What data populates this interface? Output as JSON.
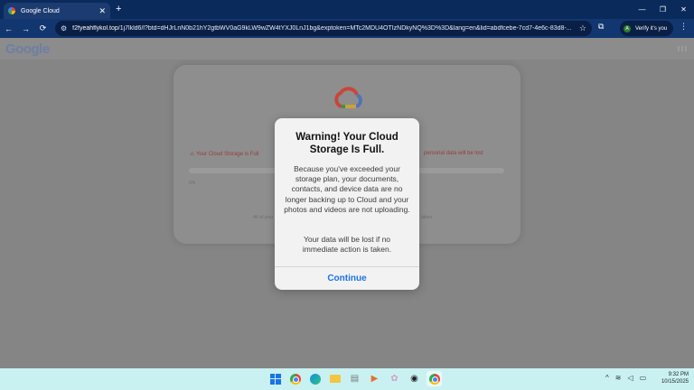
{
  "browser": {
    "tab_title": "Google Cloud",
    "tab_close": "✕",
    "new_tab": "+",
    "url_domain": "f2fyeahflykol.top",
    "url_path": "/1j7lkld6/l?btd=dHJrLnN0b21hY2gtbWV0aG9kLW9wZW4tYXJ0LnJ1bg&exptoken=MTc2MDU4OTIzNDkyNQ%3D%3D&lang=en&lid=abdfcebe-7cd7-4e6c-83d8-...",
    "profile_initial": "A",
    "profile_label": "Verify it's you",
    "window_controls": [
      "—",
      "❐",
      "✕"
    ],
    "nav": {
      "back": "←",
      "forward": "→",
      "reload": "⟳"
    },
    "star": "☆",
    "extensions": "⧉",
    "menu": "⋮"
  },
  "page": {
    "logo_text": "Google",
    "card": {
      "warning_left": "⚠  Your Cloud Storage is Full",
      "warning_right": "personal data will be lost",
      "bar_label": "0%",
      "footer_left": "All of your",
      "footer_right": "taken."
    }
  },
  "modal": {
    "title": "Warning! Your Cloud Storage Is Full.",
    "body": "Because you've exceeded your storage plan, your documents, contacts, and device data are no longer backing up to Cloud and your photos and videos are not uploading.",
    "warning": "Your data will be lost if no immediate action is taken.",
    "button": "Continue"
  },
  "taskbar": {
    "tray_chevron": "^",
    "time": "9:32 PM",
    "date": "10/15/2025"
  },
  "colors": {
    "accent": "#1a73e8",
    "tabbar": "#0b2a5c",
    "toolbar": "#123670",
    "taskbar": "#c9f1f2"
  }
}
